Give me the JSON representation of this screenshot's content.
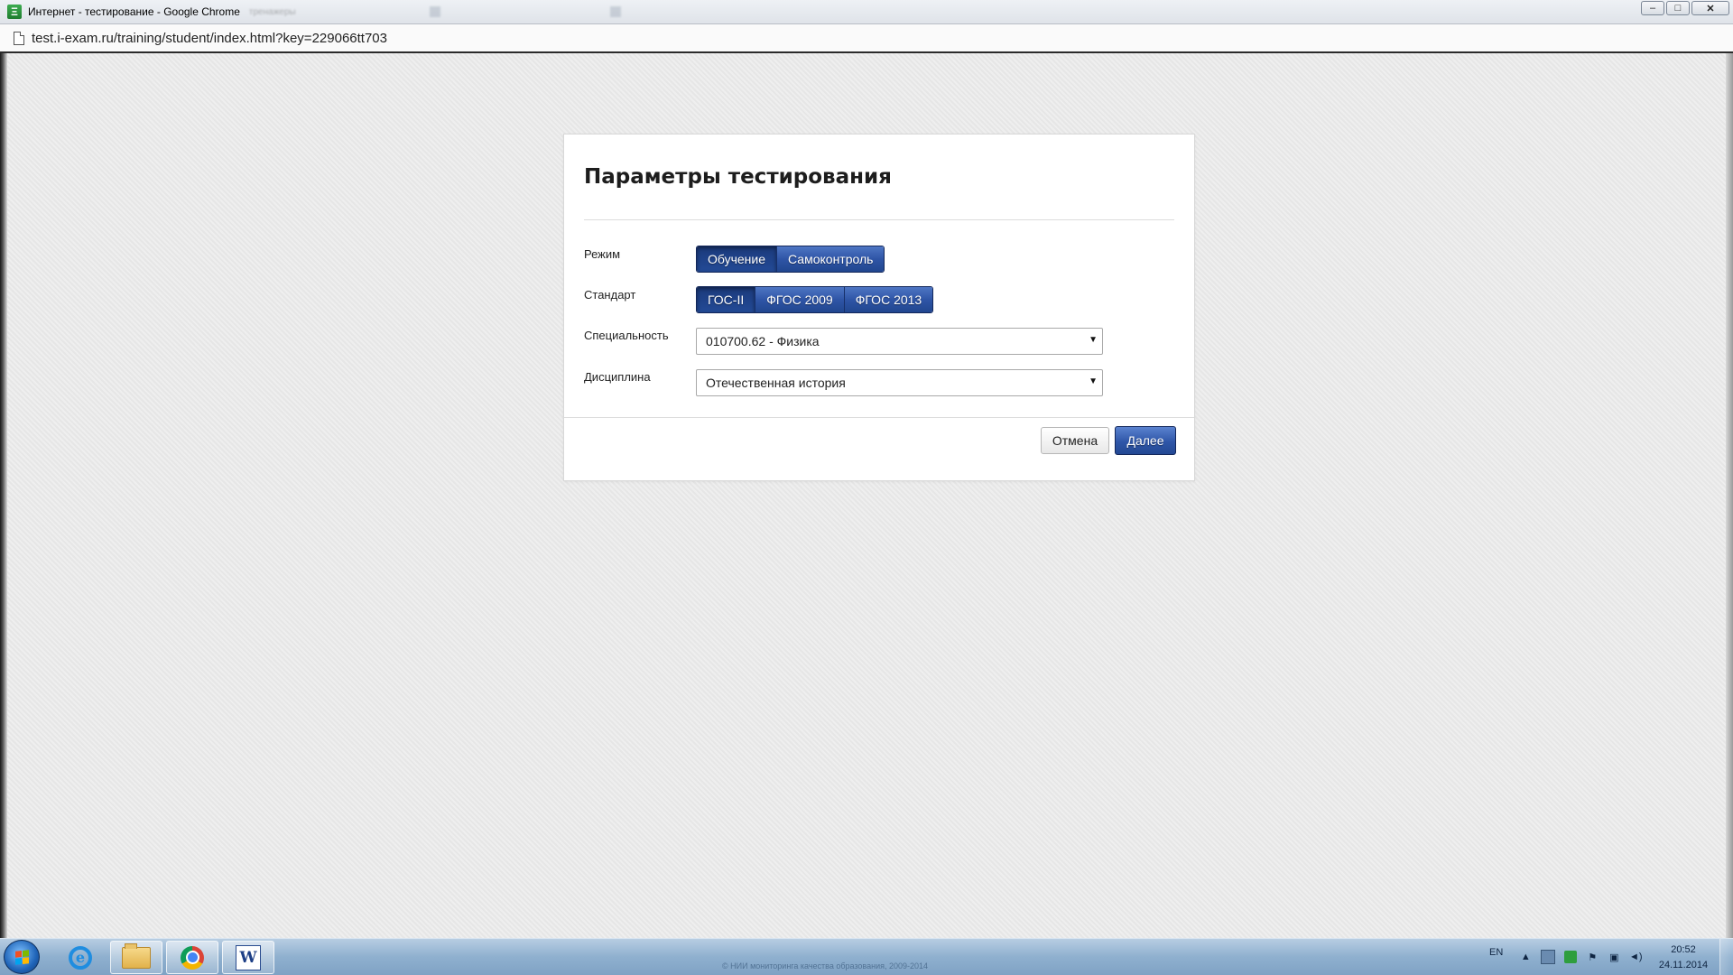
{
  "window": {
    "title": "Интернет - тестирование - Google Chrome",
    "background_tabs": [
      "тренажеры",
      "",
      ""
    ],
    "controls": {
      "minimize": "–",
      "maximize": "□",
      "close": "✕"
    }
  },
  "addressbar": {
    "url": "test.i-exam.ru/training/student/index.html?key=229066tt703",
    "icon": "page-icon"
  },
  "dialog": {
    "title": "Параметры тестирования",
    "mode": {
      "label": "Режим",
      "options": [
        "Обучение",
        "Самоконтроль"
      ],
      "selected": "Обучение"
    },
    "standard": {
      "label": "Стандарт",
      "options": [
        "ГОС-II",
        "ФГОС 2009",
        "ФГОС 2013"
      ],
      "selected": "ГОС-II"
    },
    "specialty": {
      "label": "Специальность",
      "value": "010700.62 - Физика"
    },
    "discipline": {
      "label": "Дисциплина",
      "value": "Отечественная история"
    },
    "buttons": {
      "cancel": "Отмена",
      "next": "Далее"
    }
  },
  "taskbar": {
    "footer_text": "© НИИ мониторинга качества образования, 2009-2014",
    "language": "EN",
    "time": "20:52",
    "date": "24.11.2014",
    "apps": [
      "internet-explorer-icon",
      "file-explorer-icon",
      "chrome-icon",
      "word-icon"
    ]
  },
  "colors": {
    "primary_button": "#2f56a8",
    "page_background": "#ebebeb",
    "dialog_background": "#ffffff"
  }
}
